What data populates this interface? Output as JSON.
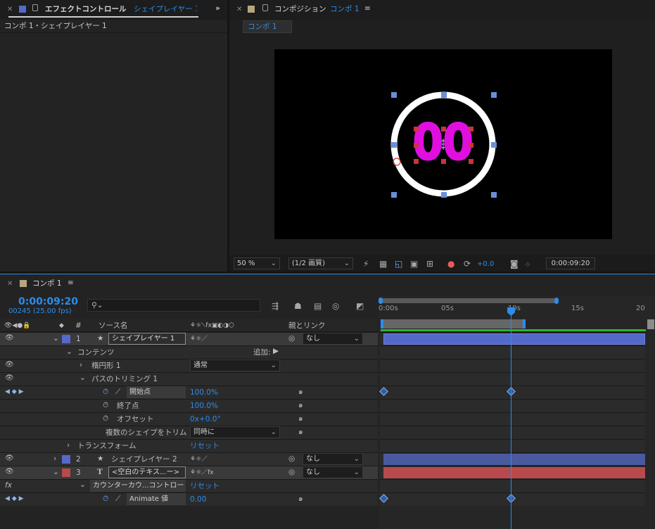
{
  "effect_panel": {
    "title": "エフェクトコントロール",
    "layer": "シェイプレイヤー 1",
    "breadcrumb": "コンポ 1・シェイプレイヤー 1"
  },
  "comp_panel": {
    "title": "コンポジション",
    "comp_name": "コンポ 1",
    "tab": "コンポ 1",
    "viewer_text": "00",
    "zoom": "50 %",
    "resolution": "(1/2 画質)",
    "exposure": "+0.0",
    "timecode": "0:00:09:20"
  },
  "timeline": {
    "tab": "コンポ 1",
    "timecode": "0:00:09:20",
    "frames": "00245 (25.00 fps)",
    "search_placeholder": "",
    "col_num": "#",
    "col_source": "ソース名",
    "col_parent": "親とリンク",
    "ticks": [
      "0:00s",
      "05s",
      "10s",
      "15s",
      "20"
    ],
    "layers": {
      "l1_num": "1",
      "l1_name": "シェイプレイヤー 1",
      "l1_parent": "なし",
      "contents": "コンテンツ",
      "add": "追加:",
      "ellipse": "楕円形 1",
      "ellipse_blend": "通常",
      "trim": "パスのトリミング 1",
      "start_label": "開始点",
      "start_value": "100.0%",
      "end_label": "終了点",
      "end_value": "100.0%",
      "offset_label": "オフセット",
      "offset_value": "0x+0.0°",
      "multi_label": "複数のシェイプをトリム",
      "multi_value": "同時に",
      "transform": "トランスフォーム",
      "reset1": "リセット",
      "l2_num": "2",
      "l2_name": "シェイプレイヤー 2",
      "l2_parent": "なし",
      "l3_num": "3",
      "l3_name": "<空白のテキス...ー>",
      "l3_parent": "なし",
      "counter": "カウンターカウ...コントロール",
      "reset2": "リセット",
      "animate_label": "Animate 値",
      "animate_value": "0.00"
    }
  },
  "colors": {
    "accent": "#2d8ceb",
    "layer1": "#5569c9",
    "layer2": "#4a5a9e",
    "layer3": "#b84a4d",
    "magenta": "#e10ee0"
  }
}
